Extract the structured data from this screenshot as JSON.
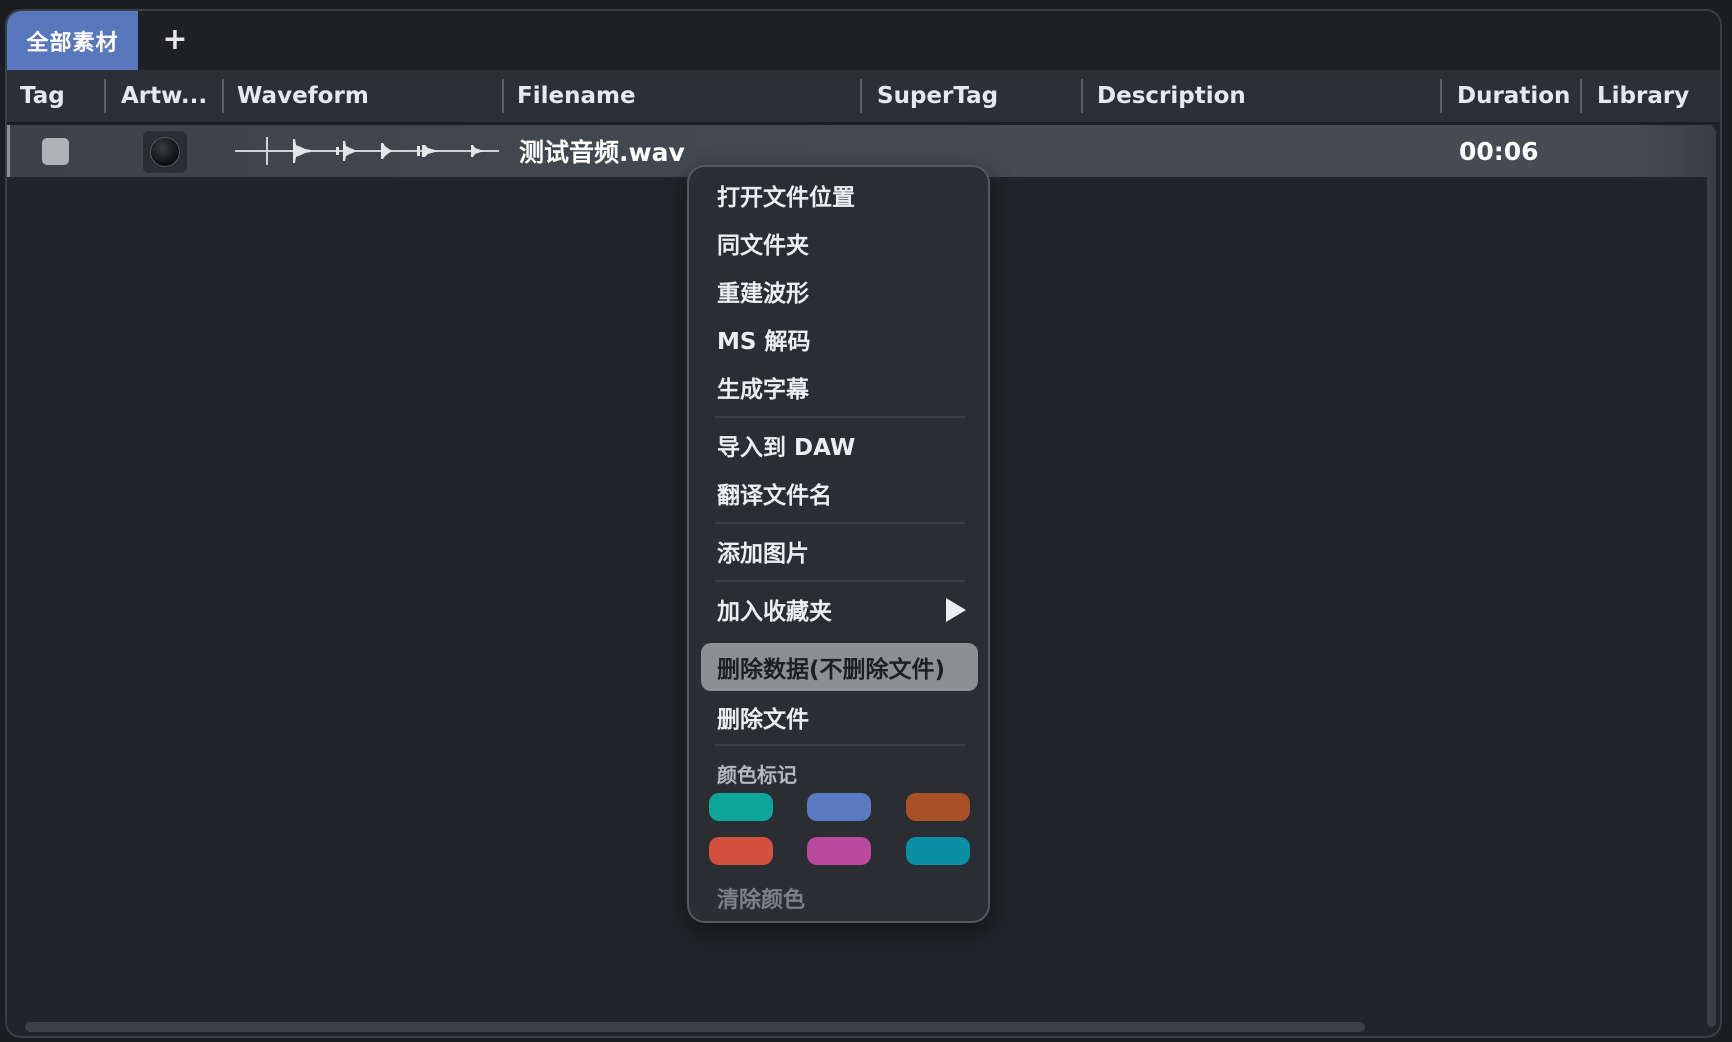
{
  "tabs": {
    "active_label": "全部素材",
    "add_label": "+"
  },
  "columns": {
    "tag": "Tag",
    "artwork": "Artw...",
    "waveform": "Waveform",
    "filename": "Filename",
    "supertag": "SuperTag",
    "description": "Description",
    "duration": "Duration",
    "library": "Library"
  },
  "rows": [
    {
      "filename": "测试音频.wav",
      "duration": "00:06",
      "artwork_icon": "knob-icon",
      "waveform_icon": "waveform-icon"
    }
  ],
  "context_menu": {
    "items": {
      "open_location": "打开文件位置",
      "same_folder": "同文件夹",
      "rebuild_waveform": "重建波形",
      "ms_decode": "MS 解码",
      "generate_subtitles": "生成字幕",
      "import_daw": "导入到 DAW",
      "translate_filename": "翻译文件名",
      "add_image": "添加图片",
      "add_favorite": "加入收藏夹",
      "delete_data": "删除数据(不删除文件)",
      "delete_file": "删除文件"
    },
    "submenu_arrow_icon": "triangle-right-icon",
    "highlighted_item": "delete_data",
    "color_section_label": "颜色标记",
    "colors": [
      "#0ea59a",
      "#5a79c0",
      "#a85128",
      "#d1513e",
      "#bb4a9e",
      "#0a8fa4"
    ],
    "clear_color_label": "清除颜色"
  },
  "theme": {
    "accent": "#5877bd",
    "background": "#212428"
  }
}
